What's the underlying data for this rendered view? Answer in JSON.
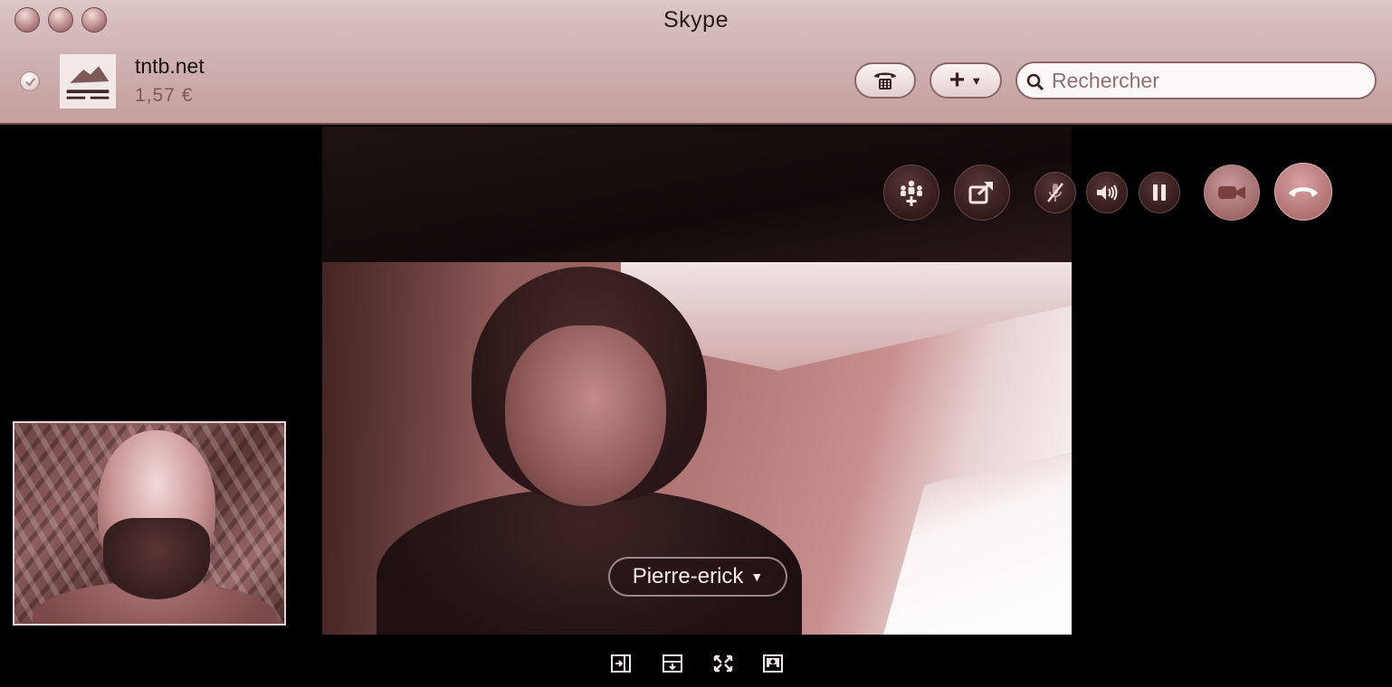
{
  "window": {
    "title": "Skype"
  },
  "account": {
    "name": "tntb.net",
    "credit": "1,57 €"
  },
  "toolbar": {
    "search_placeholder": "Rechercher",
    "add_label": "+"
  },
  "call": {
    "participant_name": "Pierre-erick"
  },
  "icons": {
    "status": "check-icon",
    "dialpad": "phone-dialpad-icon",
    "search": "search-icon",
    "add_participant": "add-participant-icon",
    "share": "share-screen-icon",
    "mute": "microphone-mute-icon",
    "volume": "speaker-icon",
    "pause": "pause-icon",
    "video": "video-camera-icon",
    "hangup": "hang-up-icon"
  },
  "colors": {
    "hangup": "#b87070",
    "chrome": "#cfb3b3",
    "accent": "#8a6666"
  }
}
